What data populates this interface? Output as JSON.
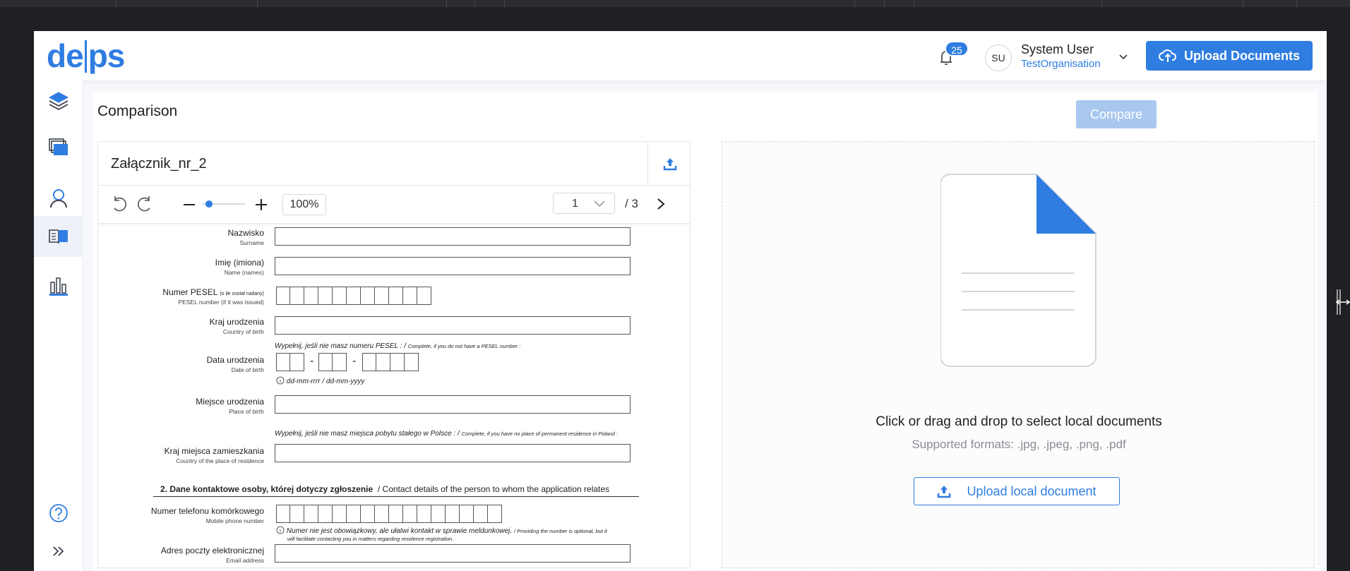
{
  "colors": {
    "accent": "#2f7de1",
    "accent_disabled": "#a9c8f0",
    "frame_bg": "#1f2023"
  },
  "app": {
    "logo_left": "de",
    "logo_right": "ps"
  },
  "header": {
    "notifications_count": "25",
    "avatar_initials": "SU",
    "user_name": "System User",
    "organisation": "TestOrganisation",
    "upload_label": "Upload Documents"
  },
  "sidebar": {
    "items": [
      {
        "icon": "layers-icon"
      },
      {
        "icon": "documents-icon"
      },
      {
        "icon": "user-icon"
      },
      {
        "icon": "book-icon",
        "active": true
      },
      {
        "icon": "bar-chart-icon"
      },
      {
        "icon": "help-icon"
      },
      {
        "icon": "expand-icon"
      }
    ]
  },
  "page": {
    "title": "Comparison",
    "compare_label": "Compare"
  },
  "document": {
    "name": "Załącznik_nr_2",
    "zoom": "100%",
    "page_current": "1",
    "page_total": "/ 3",
    "zoom_level": 0.15
  },
  "form": {
    "surname_pl": "Nazwisko",
    "surname_en": "Surname",
    "name_pl": "Imię (imiona)",
    "name_en": "Name (names)",
    "pesel_pl": "Numer PESEL",
    "pesel_pl_small": "(o ile został nadany)",
    "pesel_en": "PESEL number (if it was issued)",
    "country_pl": "Kraj urodzenia",
    "country_en": "Country of birth",
    "note_pesel": "Wypełnij, jeśli nie masz numeru PESEL : /",
    "note_pesel_en": "Complete, if you do not have a PESEL number :",
    "dob_pl": "Data urodzenia",
    "dob_en": "Date of birth",
    "dob_hint": "dd-mm-rrrr / dd-mm-yyyy",
    "pob_pl": "Miejsce urodzenia",
    "pob_en": "Place of birth",
    "note_residence": "Wypełnij, jeśli nie masz miejsca pobytu stałego w Polsce : /",
    "note_residence_en": "Complete, if you have no place of permanent  residence in Poland :",
    "res_pl": "Kraj miejsca zamieszkania",
    "res_en": "Country of the place of residence",
    "section_pl": "2.  Dane kontaktowe osoby, której dotyczy zgłoszenie",
    "section_en": "/ Contact details of the person to whom the application relates",
    "phone_pl": "Numer telefonu komórkowego",
    "phone_en": "Mobile phone number",
    "phone_note": "Numer nie jest obowiązkowy, ale ułatwi kontakt w sprawie meldunkowej.",
    "phone_note_en": "/ Providing the number is optional, but it",
    "phone_note_en2": "will facilitate contacting you in matters regarding residence registration.",
    "email_pl": "Adres poczty elektronicznej",
    "email_en": "Email address"
  },
  "dropzone": {
    "title": "Click or drag and drop to select local documents",
    "formats": "Supported formats: .jpg, .jpeg, .png, .pdf",
    "button_label": "Upload local document"
  }
}
